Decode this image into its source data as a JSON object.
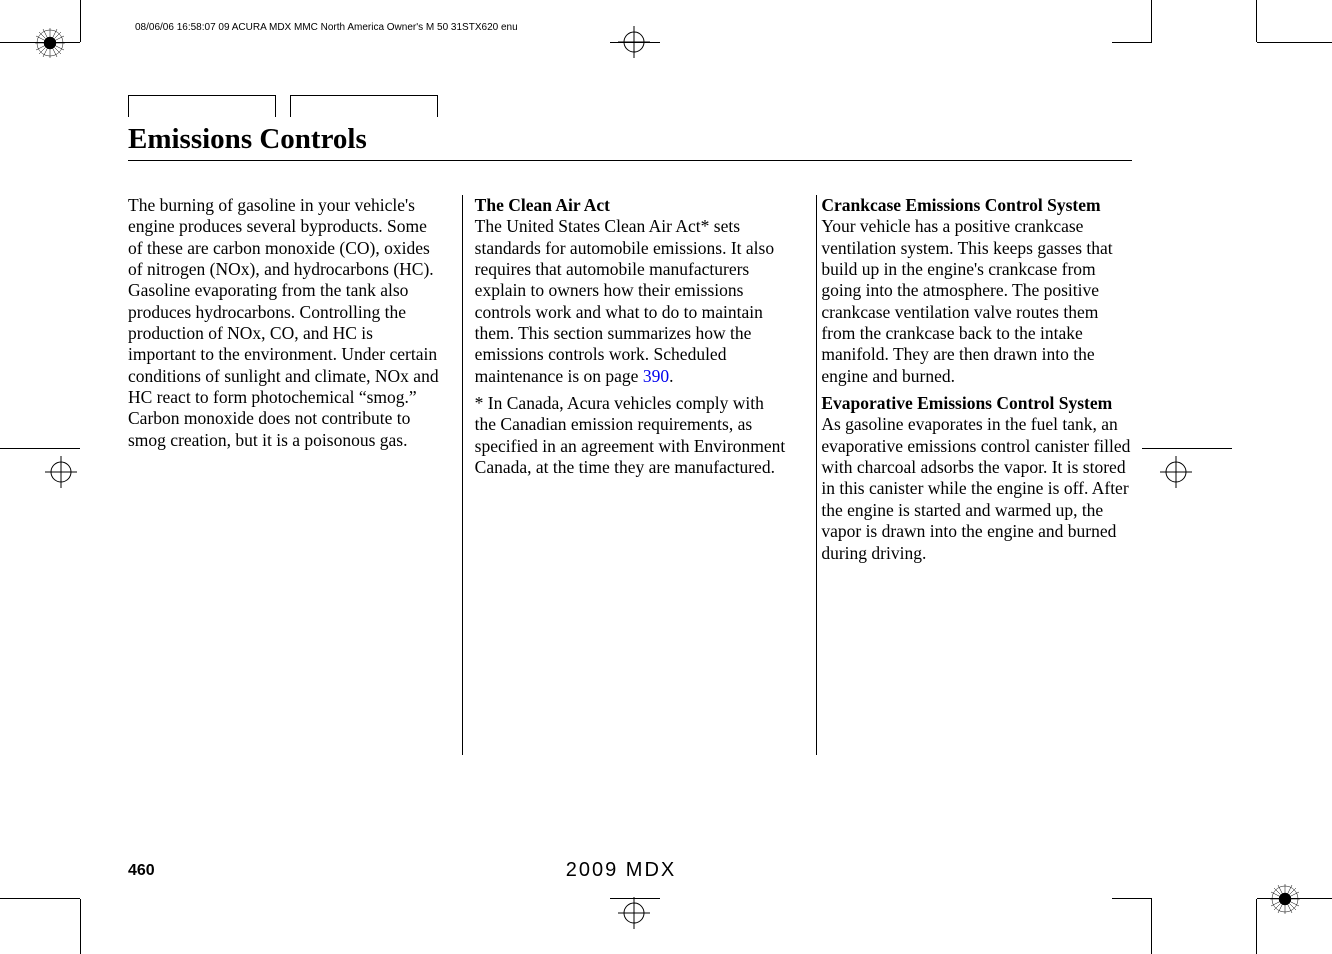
{
  "header_line": "08/06/06 16:58:07   09 ACURA MDX MMC North America Owner's M 50 31STX620 enu",
  "section_title": "Emissions Controls",
  "column1": {
    "p1": "The burning of gasoline in your vehicle's engine produces several byproducts. Some of these are carbon monoxide (CO), oxides of nitrogen (NOx), and hydrocarbons (HC). Gasoline evaporating from the tank also produces hydrocarbons. Controlling the production of NOx, CO, and HC is important to the environment. Under certain conditions of sunlight and climate, NOx and HC react to form photochemical “smog.” Carbon monoxide does not contribute to smog creation, but it is a poisonous gas."
  },
  "column2": {
    "heading1": "The Clean Air Act",
    "p1a": "The United States Clean Air Act",
    "p1b": " sets standards for automobile emissions. It also requires that automobile manufacturers explain to owners how their emissions controls work and what to do to maintain them. This section summarizes how the emissions controls work. Scheduled maintenance is on page ",
    "link": "390",
    "p1c": ".",
    "asterisk": "*",
    "p2": " In Canada, Acura vehicles comply with the Canadian emission requirements, as specified in an agreement with Environment Canada, at the time they are manufactured."
  },
  "column3": {
    "heading1": "Crankcase Emissions Control System",
    "p1": "Your vehicle has a positive crankcase ventilation system. This keeps gasses that build up in the engine's crankcase from going into the atmosphere. The positive crankcase ventilation valve routes them from the crankcase back to the intake manifold. They are then drawn into the engine and burned.",
    "heading2": "Evaporative Emissions Control System",
    "p2": "As gasoline evaporates in the fuel tank, an evaporative emissions control canister filled with charcoal adsorbs the vapor. It is stored in this canister while the engine is off. After the engine is started and warmed up, the vapor is drawn into the engine and burned during driving."
  },
  "page_number": "460",
  "footer_model": "2009  MDX"
}
